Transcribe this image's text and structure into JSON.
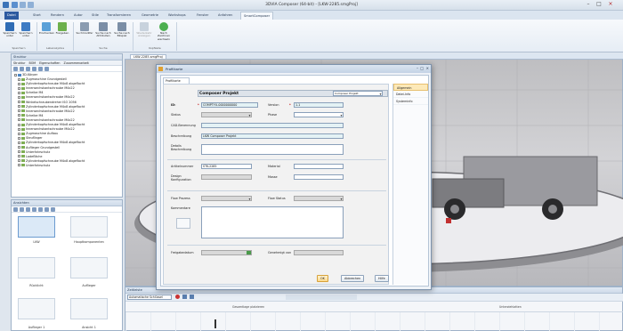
{
  "app": {
    "title": "3DVIA Composer (64-bit) - [LKW-2285.smgProj]"
  },
  "window_controls": {
    "minimize": "–",
    "maximize": "□",
    "close": "×"
  },
  "ribbon_tabs": [
    "Datei",
    "Start",
    "Rendern",
    "Autor",
    "Stile",
    "Transformieren",
    "Geometrie",
    "Workshops",
    "Fenster",
    "Anfahren",
    "SmartComposer"
  ],
  "ribbon": {
    "groups": [
      {
        "label": "Speichern",
        "buttons": [
          "Speichern unter",
          "Speichern unter"
        ]
      },
      {
        "label": "Lebenszyklus",
        "buttons": [
          "Einchecken",
          "Freigeben"
        ]
      },
      {
        "label": "Suche",
        "buttons": [
          "Suchmodifer",
          "Suche nach Attributen",
          "Suche nach Bilspiel"
        ]
      },
      {
        "label": "Kopfzeile",
        "buttons": [
          "Wiederkehr anzeigen",
          "Nach Zeichnen wechseln"
        ]
      }
    ]
  },
  "structure_panel": {
    "title": "Struktur",
    "tabs": [
      "Struktur",
      "BOM",
      "Eigenschaften",
      "Zusammenarbeit"
    ],
    "items": [
      "3D-Körper",
      "Zugmaschine Grundgestell",
      "Zylinderkopfschraube M4x8 abgeflacht",
      "Innensechskantschraube M4x22",
      "Scheibe M4",
      "Innensechskantschraube M4x22",
      "Winkelschraubendreher ISO 2056",
      "Zylinderkopfschraube M4x8 abgeflacht",
      "Innensechskantschraube M4x22",
      "Scheibe M4",
      "Innensechskantschraube M4x22",
      "Zylinderkopfschraube M4x8 abgeflacht",
      "Innensechskantschraube M4x22",
      "Zugmaschine Aufbau",
      "Steuflinger",
      "Zylinderkopfschraube M4x8 abgeflacht",
      "Auflieger Grundgestell",
      "Unterfahrschutz",
      "Ladefläche",
      "Zylinderkopfschraube M4x8 abgeflacht",
      "Unterfahrschutz"
    ]
  },
  "thumbs_panel": {
    "title": "Ansichten",
    "items": [
      "LKW",
      "Hauptkomponenten",
      "Rücklicht",
      "Auflieger",
      "Auflieger 1",
      "Ansicht 1"
    ]
  },
  "document_tab": "LKW-2285.smgProj",
  "timeline": {
    "title": "Zeitleiste",
    "dropdown": "Automatische Schlüssel",
    "marker_left": "Gesamtlage platzieren",
    "marker_right": "Unterziehlatten"
  },
  "dialog": {
    "title": "Profilkarte",
    "tab": "Profilkarte",
    "sidebar": [
      "Allgemein",
      "Datei-Info",
      "Systeminfo"
    ],
    "project_name": "Composer Projekt",
    "project_type": "Composer Projekt",
    "fields": {
      "id_label": "ID:",
      "id_value": "COMPTYU-0000000000",
      "version_label": "Version",
      "version_value": "1.1",
      "status_label": "Status",
      "status_value": "",
      "phase_label": "Phase",
      "phase_value": "",
      "cad_label": "CAD-Benennung",
      "cad_value": "",
      "desc_label": "Beschreibung",
      "desc_value": "LKW Composer Projekt",
      "detail_label": "Details Beschreibung",
      "detail_value": "",
      "article_label": "Artikelnummer",
      "article_value": "STK-2285",
      "material_label": "Material",
      "material_value": "",
      "design_label": "Design Konfiguration",
      "design_value": "",
      "weight_label": "Masse",
      "weight_value": "",
      "flow_process_label": "Flow Prozess",
      "flow_process_value": "",
      "flow_status_label": "Flow Status",
      "flow_status_value": "",
      "comment_label": "Kommentare",
      "comment_value": "",
      "release_label": "Freigabedatum",
      "release_value": "",
      "approved_label": "Genehmigt von",
      "approved_value": ""
    },
    "buttons": {
      "ok": "OK",
      "cancel": "Abbrechen",
      "help": "Hilfe"
    }
  },
  "colors": {
    "file_tab": "#2c5aa0",
    "accent": "#4a86c5",
    "required": "#c00000",
    "tinted_field": "#e4f2f5"
  }
}
